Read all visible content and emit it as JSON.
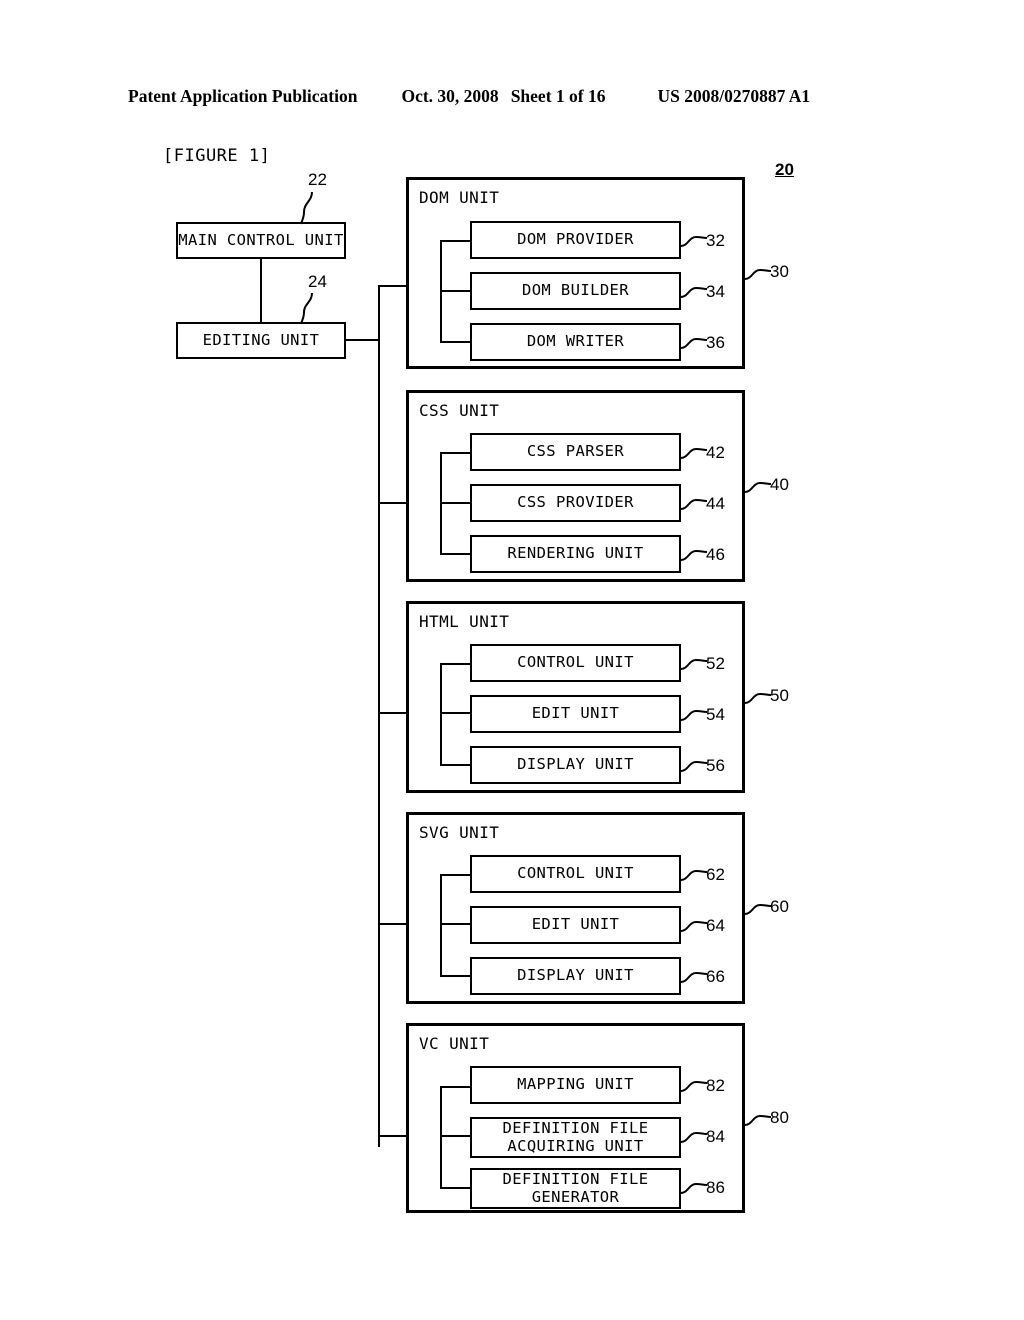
{
  "header": {
    "publication": "Patent Application Publication",
    "date": "Oct. 30, 2008",
    "sheet": "Sheet 1 of 16",
    "patent_number": "US 2008/0270887 A1"
  },
  "figure": {
    "label": "[FIGURE 1]",
    "system_ref": "20",
    "left_blocks": [
      {
        "label": "MAIN CONTROL UNIT",
        "ref": "22"
      },
      {
        "label": "EDITING UNIT",
        "ref": "24"
      }
    ],
    "units": [
      {
        "title": "DOM UNIT",
        "ref": "30",
        "subunits": [
          {
            "label": "DOM PROVIDER",
            "ref": "32"
          },
          {
            "label": "DOM BUILDER",
            "ref": "34"
          },
          {
            "label": "DOM WRITER",
            "ref": "36"
          }
        ]
      },
      {
        "title": "CSS UNIT",
        "ref": "40",
        "subunits": [
          {
            "label": "CSS PARSER",
            "ref": "42"
          },
          {
            "label": "CSS PROVIDER",
            "ref": "44"
          },
          {
            "label": "RENDERING UNIT",
            "ref": "46"
          }
        ]
      },
      {
        "title": "HTML UNIT",
        "ref": "50",
        "subunits": [
          {
            "label": "CONTROL UNIT",
            "ref": "52"
          },
          {
            "label": "EDIT UNIT",
            "ref": "54"
          },
          {
            "label": "DISPLAY UNIT",
            "ref": "56"
          }
        ]
      },
      {
        "title": "SVG UNIT",
        "ref": "60",
        "subunits": [
          {
            "label": "CONTROL UNIT",
            "ref": "62"
          },
          {
            "label": "EDIT UNIT",
            "ref": "64"
          },
          {
            "label": "DISPLAY UNIT",
            "ref": "66"
          }
        ]
      },
      {
        "title": "VC UNIT",
        "ref": "80",
        "subunits": [
          {
            "label": "MAPPING UNIT",
            "ref": "82"
          },
          {
            "label": "DEFINITION FILE\nACQUIRING UNIT",
            "ref": "84"
          },
          {
            "label": "DEFINITION FILE\nGENERATOR",
            "ref": "86"
          }
        ]
      }
    ]
  }
}
